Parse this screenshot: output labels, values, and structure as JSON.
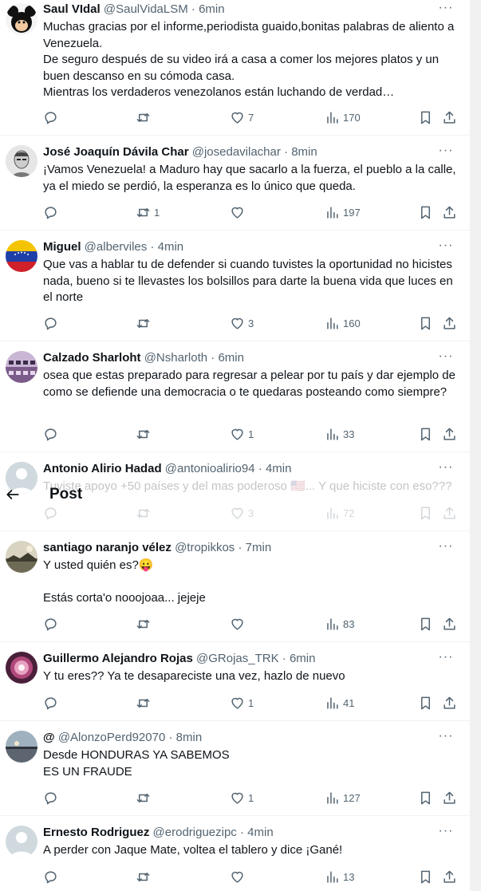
{
  "header": {
    "title": "Post",
    "back_icon": "arrow-left-icon"
  },
  "tweets": [
    {
      "name": "Saul VIdal",
      "handle": "@SaulVidaLSM",
      "time": "6min",
      "avatar_icon": "mickey-avatar",
      "text": "Muchas gracias por el informe,periodista guaido,bonitas palabras de aliento a Venezuela.\nDe seguro después de su video irá a casa a comer los mejores platos y un buen descanso en su cómoda casa.\nMientras los verdaderos venezolanos están luchando de verdad…",
      "replies": "",
      "retweets": "",
      "likes": "7",
      "views": "170"
    },
    {
      "name": "José Joaquín Dávila Char",
      "handle": "@josedavilachar",
      "time": "8min",
      "avatar_icon": "sketch-portrait-avatar",
      "text": "¡Vamos Venezuela! a Maduro hay que sacarlo a la fuerza, el pueblo a la calle, ya el miedo se perdió, la esperanza es lo único que queda.",
      "replies": "",
      "retweets": "1",
      "likes": "",
      "views": "197"
    },
    {
      "name": "Miguel",
      "handle": "@alberviles",
      "time": "4min",
      "avatar_icon": "venezuela-flag-avatar",
      "text": "Que vas a hablar tu de defender si cuando tuvistes la oportunidad no hicistes nada, bueno si te llevastes los bolsillos para darte la buena vida que luces en el norte",
      "replies": "",
      "retweets": "",
      "likes": "3",
      "views": "160"
    },
    {
      "name": "Calzado Sharloht",
      "handle": "@Nsharloth",
      "time": "6min",
      "avatar_icon": "shoes-avatar",
      "text": "osea que estas preparado para regresar a pelear por tu país y dar ejemplo de como se defiende una democracia o te quedaras posteando como siempre?",
      "replies": "",
      "retweets": "",
      "likes": "1",
      "views": "33"
    },
    {
      "name": "Antonio Alirio Hadad",
      "handle": "@antonioalirio94",
      "time": "4min",
      "avatar_icon": "default-avatar",
      "text": "Tuviste apoyo +50 países y del mas poderoso 🇺🇸... Y que hiciste con eso???",
      "replies": "",
      "retweets": "",
      "likes": "3",
      "views": "72"
    },
    {
      "name": "santiago naranjo vélez",
      "handle": "@tropikkos",
      "time": "7min",
      "avatar_icon": "landscape-avatar",
      "text": "Y usted quién es?😛\n\nEstás corta'o nooojoaa... jejeje",
      "replies": "",
      "retweets": "",
      "likes": "",
      "views": "83"
    },
    {
      "name": "Guillermo Alejandro Rojas",
      "handle": "@GRojas_TRK",
      "time": "6min",
      "avatar_icon": "pattern-avatar",
      "text": "Y tu eres?? Ya te desapareciste una vez, hazlo de nuevo",
      "replies": "",
      "retweets": "",
      "likes": "1",
      "views": "41"
    },
    {
      "name": "@",
      "handle": "@AlonzoPerd92070",
      "time": "8min",
      "avatar_icon": "sunset-avatar",
      "text": "Desde HONDURAS YA SABEMOS\nES UN FRAUDE",
      "replies": "",
      "retweets": "",
      "likes": "1",
      "views": "127"
    },
    {
      "name": "Ernesto Rodriguez",
      "handle": "@erodriguezipc",
      "time": "4min",
      "avatar_icon": "default-avatar",
      "text": "A perder con Jaque Mate, voltea el tablero y dice ¡Gané!",
      "replies": "",
      "retweets": "",
      "likes": "",
      "views": "13"
    }
  ]
}
